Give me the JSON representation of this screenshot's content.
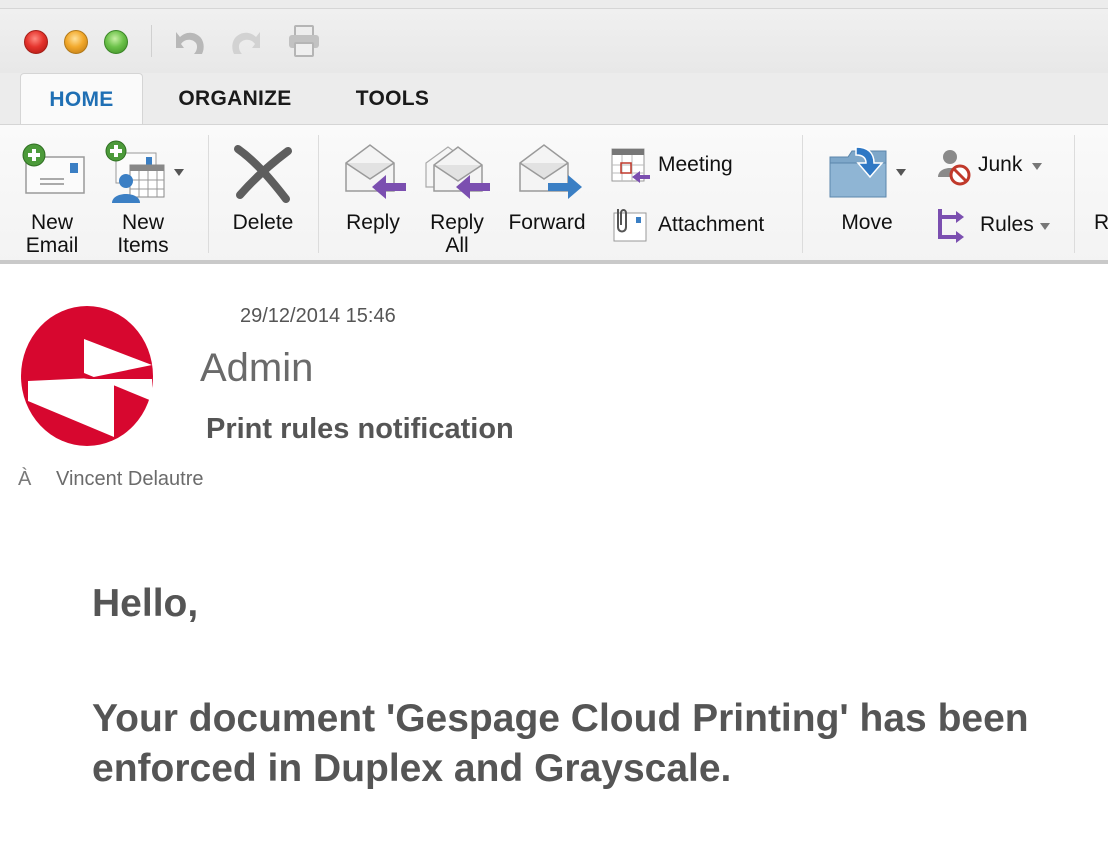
{
  "window": {
    "controls": [
      "close",
      "minimize",
      "maximize"
    ],
    "quick_access": [
      {
        "icon": "undo-icon",
        "enabled": false
      },
      {
        "icon": "redo-icon",
        "enabled": false
      },
      {
        "icon": "print-icon",
        "enabled": false
      }
    ]
  },
  "tabs": [
    {
      "label": "HOME",
      "active": true
    },
    {
      "label": "ORGANIZE",
      "active": false
    },
    {
      "label": "TOOLS",
      "active": false
    }
  ],
  "ribbon": {
    "new_email": {
      "line1": "New",
      "line2": "Email",
      "icon": "new-email-icon"
    },
    "new_items": {
      "line1": "New",
      "line2": "Items",
      "icon": "new-items-icon"
    },
    "delete": {
      "label": "Delete",
      "icon": "delete-icon"
    },
    "reply": {
      "label": "Reply",
      "icon": "reply-icon"
    },
    "reply_all": {
      "line1": "Reply",
      "line2": "All",
      "icon": "reply-all-icon"
    },
    "forward": {
      "label": "Forward",
      "icon": "forward-icon"
    },
    "meeting": {
      "label": "Meeting",
      "icon": "meeting-icon"
    },
    "attachment": {
      "label": "Attachment",
      "icon": "attachment-icon"
    },
    "move": {
      "label": "Move",
      "icon": "move-folder-icon"
    },
    "junk": {
      "label": "Junk",
      "icon": "junk-icon"
    },
    "rules": {
      "label": "Rules",
      "icon": "rules-icon"
    },
    "truncated": {
      "label": "R"
    }
  },
  "message": {
    "date": "29/12/2014 15:46",
    "sender": "Admin",
    "subject": "Print rules notification",
    "to_label": "À",
    "to": "Vincent Delautre",
    "greeting": "Hello,",
    "body": "Your document 'Gespage Cloud Printing' has been enforced in Duplex and Grayscale."
  },
  "colors": {
    "accent": "#1f6fb4",
    "logo_red": "#d7072f",
    "reply_arrow": "#7b4fb0",
    "forward_arrow": "#3b7fc4"
  }
}
